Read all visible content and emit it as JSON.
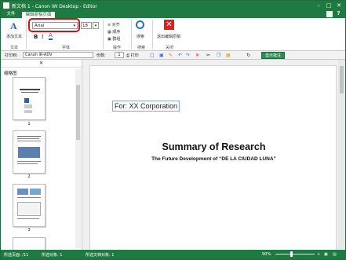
{
  "window": {
    "title": "新文档 1 - Canon iW Desktop - Editor",
    "help": "?"
  },
  "tabs": [
    {
      "label": "文件"
    },
    {
      "label": "编辑原稿页面"
    }
  ],
  "ribbon": {
    "add_text": "添加文本",
    "font_name": "Arial",
    "font_size": "18",
    "align": "对齐",
    "order": "顺序",
    "group": "群组",
    "search": "搜索",
    "exit": "退出编辑原稿",
    "groups": {
      "text": "文本",
      "font": "字体",
      "operate": "操作",
      "search": "搜索",
      "close": "关闭"
    }
  },
  "toolbar": {
    "print_label": "打印到:",
    "printer": "Canon iR-ADV",
    "copies_label": "份数:",
    "copies": "1",
    "print": "打印",
    "show_note": "显示批注"
  },
  "thumbs": {
    "label": "缩略图",
    "pages": [
      "1",
      "2",
      "3"
    ]
  },
  "doc": {
    "for_text": "For: XX Corporation",
    "title": "Summary of Research",
    "subtitle": "The Future Development of “DE LA CIUDAD LUNA”"
  },
  "status": {
    "pages": "所选页面: /11",
    "selected": "所选对象: 1",
    "docobj": "所选文档对象: 1",
    "zoom": "90%"
  }
}
